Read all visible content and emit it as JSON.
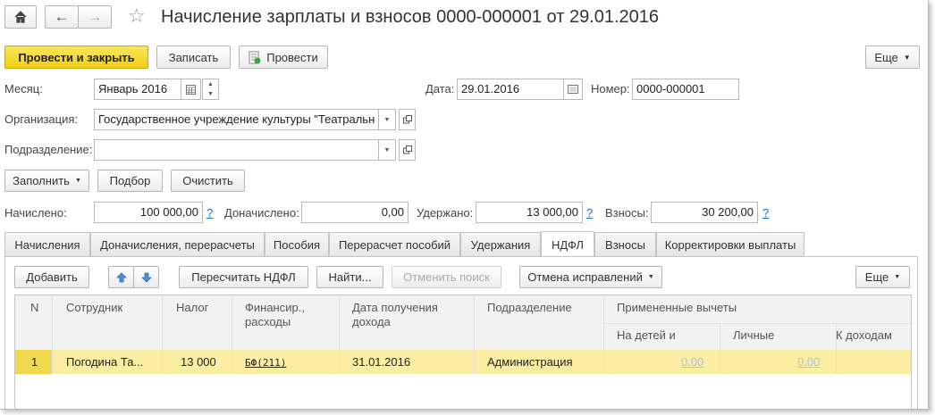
{
  "window": {
    "title": "Начисление зарплаты и взносов 0000-000001 от 29.01.2016"
  },
  "toolbar": {
    "post_close": "Провести и закрыть",
    "save": "Записать",
    "post": "Провести",
    "more": "Еще"
  },
  "form": {
    "month_label": "Месяц:",
    "month_value": "Январь 2016",
    "date_label": "Дата:",
    "date_value": "29.01.2016",
    "number_label": "Номер:",
    "number_value": "0000-000001",
    "organization_label": "Организация:",
    "organization_value": "Государственное учреждение культуры \"Театральн",
    "subdivision_label": "Подразделение:",
    "subdivision_value": "",
    "fill": "Заполнить",
    "select": "Подбор",
    "clear": "Очистить"
  },
  "totals": {
    "accrued_label": "Начислено:",
    "accrued_value": "100 000,00",
    "extra_label": "Доначислено:",
    "extra_value": "0,00",
    "withheld_label": "Удержано:",
    "withheld_value": "13 000,00",
    "contributions_label": "Взносы:",
    "contributions_value": "30 200,00",
    "help": "?"
  },
  "tabs": [
    "Начисления",
    "Доначисления, перерасчеты",
    "Пособия",
    "Перерасчет пособий",
    "Удержания",
    "НДФЛ",
    "Взносы",
    "Корректировки выплаты"
  ],
  "active_tab": "НДФЛ",
  "grid_toolbar": {
    "add": "Добавить",
    "recalc": "Пересчитать НДФЛ",
    "find": "Найти...",
    "cancel_search": "Отменить поиск",
    "cancel_corrections": "Отмена исправлений",
    "more": "Еще"
  },
  "table": {
    "columns": [
      "N",
      "Сотрудник",
      "Налог",
      "Финансир., расходы",
      "Дата получения дохода",
      "Подразделение",
      "Примененные вычеты"
    ],
    "subcolumns": [
      "На детей и",
      "Личные",
      "К доходам"
    ],
    "rows": [
      {
        "n": "1",
        "employee": "Погодина Та...",
        "tax": "13 000",
        "financing": "БФ(211)",
        "income_date": "31.01.2016",
        "subdivision": "Администрация",
        "for_children": "0.00",
        "personal": "0.00"
      }
    ]
  },
  "colors": {
    "primary_button": "#f5d723",
    "selected_row": "#fbeea3",
    "link": "#1c6bd0"
  }
}
